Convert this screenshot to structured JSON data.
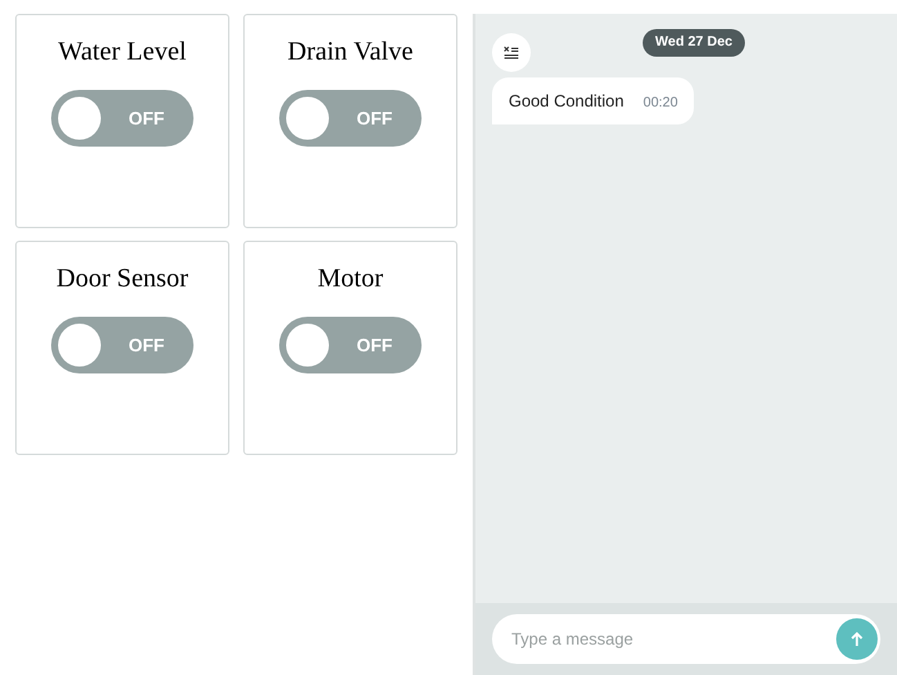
{
  "switches": [
    {
      "label": "Water Level",
      "on": false,
      "state_text": "OFF"
    },
    {
      "label": "Drain Valve",
      "on": false,
      "state_text": "OFF"
    },
    {
      "label": "Door Sensor",
      "on": false,
      "state_text": "OFF"
    },
    {
      "label": "Motor",
      "on": false,
      "state_text": "OFF"
    }
  ],
  "chat": {
    "date": "Wed 27 Dec",
    "messages": [
      {
        "text": "Good Condition",
        "time": "00:20"
      }
    ],
    "input": {
      "placeholder": "Type a message"
    }
  }
}
